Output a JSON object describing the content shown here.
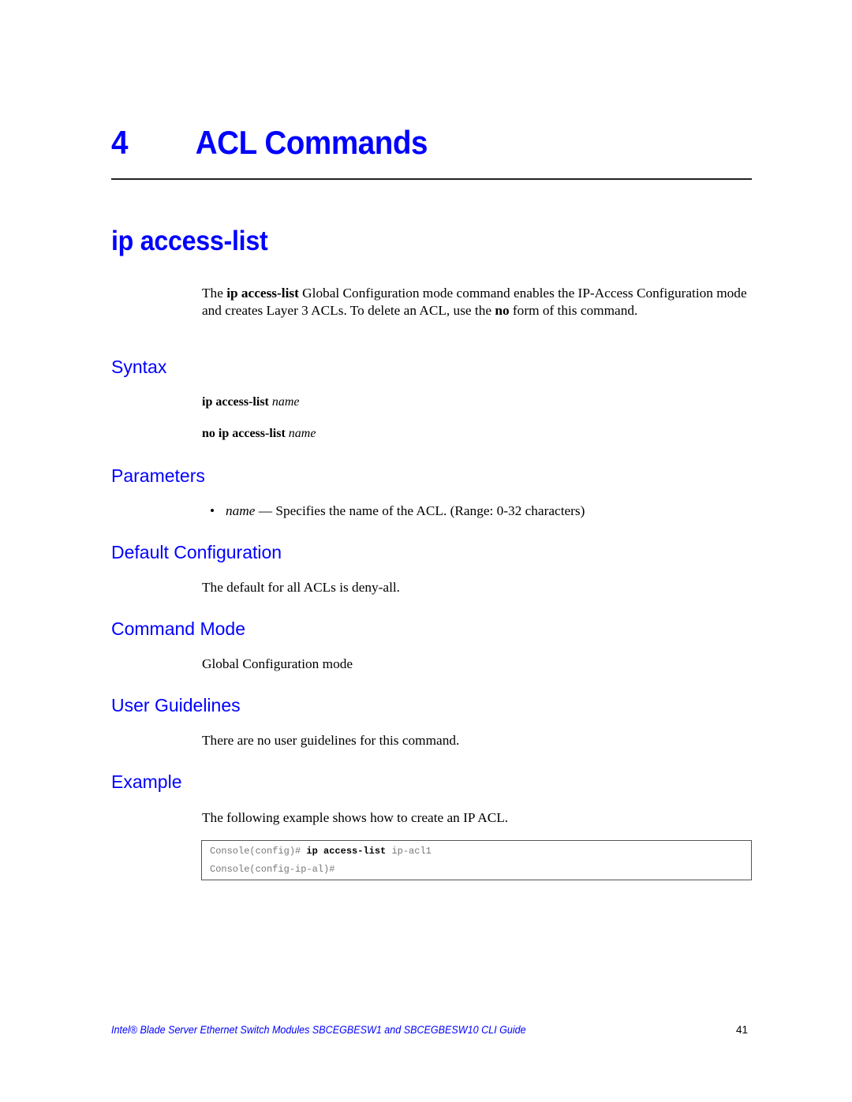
{
  "chapter": {
    "number": "4",
    "title": "ACL Commands"
  },
  "command": {
    "title": "ip access-list",
    "description": {
      "pre1": "The ",
      "bold1": "ip access-list",
      "mid1": " Global Configuration mode command enables the IP-Access Configuration mode and creates Layer 3 ACLs. To delete an ACL, use the ",
      "bold2": "no",
      "post": " form of this command."
    }
  },
  "syntax": {
    "heading": "Syntax",
    "lines": [
      {
        "bold": "ip access-list",
        "italic": "name"
      },
      {
        "bold": "no ip access-list",
        "italic": "name"
      }
    ]
  },
  "parameters": {
    "heading": "Parameters",
    "items": [
      {
        "bullet": "•",
        "name": "name",
        "text": " — Specifies the name of the ACL. (Range: 0-32 characters)"
      }
    ]
  },
  "default_configuration": {
    "heading": "Default Configuration",
    "text": "The default for all ACLs is deny-all."
  },
  "command_mode": {
    "heading": "Command Mode",
    "text": "Global Configuration mode"
  },
  "user_guidelines": {
    "heading": "User Guidelines",
    "text": "There are no user guidelines for this command."
  },
  "example": {
    "heading": "Example",
    "intro": "The following example shows how to create an IP ACL.",
    "code": [
      {
        "prompt": "Console(config)# ",
        "cmd": "ip access-list",
        "arg": " ip-acl1"
      },
      {
        "prompt": "Console(config-ip-al)#",
        "cmd": "",
        "arg": ""
      }
    ]
  },
  "footer": {
    "title": "Intel® Blade Server Ethernet Switch Modules SBCEGBESW1 and SBCEGBESW10 CLI Guide",
    "page_number": "41"
  },
  "colors": {
    "heading_blue": "#0000ff",
    "code_gray": "#777777"
  }
}
